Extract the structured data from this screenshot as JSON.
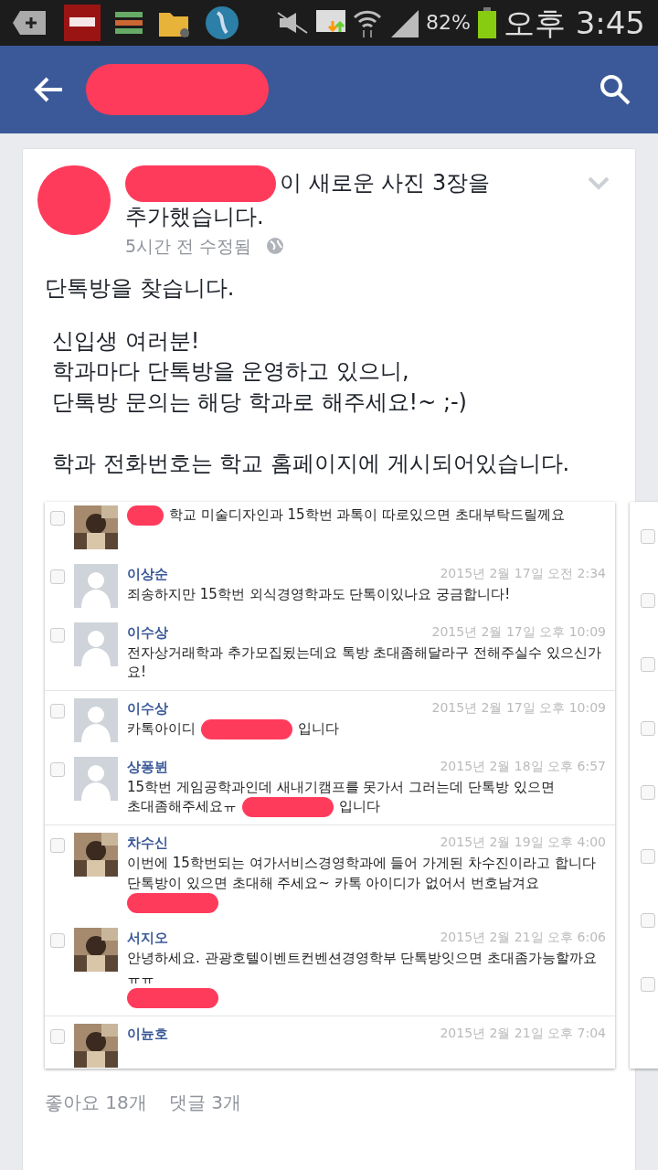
{
  "status_bar": {
    "battery": "82%",
    "time": "오후 3:45"
  },
  "post": {
    "action_lines": [
      "이 새로운 사진 3장을",
      "추가했습니다."
    ],
    "meta": "5시간 전 수정됨",
    "body": [
      [
        "단톡방을 찾습니다."
      ],
      [
        "신입생 여러분!",
        "학과마다 단톡방을 운영하고 있으니,",
        "단톡방 문의는 해당 학과로 해주세요!~ ;-)"
      ],
      [
        "학과 전화번호는 학교 홈페이지에 게시되어있습니다."
      ]
    ],
    "photo": {
      "comments": [
        {
          "checked": false,
          "divider": false,
          "parts": [
            {
              "kind": "redaction"
            },
            {
              "kind": "text",
              "text": "학교 미술디자인과 15학번 과톡이 따로있으면 초대부탁드릴께요"
            }
          ]
        },
        {
          "name": "이상순",
          "date": "2015년 2월 17일 오전 2:34",
          "kind": "default",
          "checked": false,
          "divider": false,
          "parts": [
            {
              "kind": "text",
              "text": "죄송하지만 15학번 외식경영학과도 단톡이있나요 궁금합니다!"
            }
          ]
        },
        {
          "name": "이수상",
          "date": "2015년 2월 17일 오후 10:09",
          "kind": "default",
          "checked": false,
          "divider": true,
          "parts": [
            {
              "kind": "text",
              "text": "전자상거래학과 추가모집됬는데요 톡방 초대좀해달라구 전해주실수 있으신가요!"
            }
          ]
        },
        {
          "name": "이수상",
          "date": "2015년 2월 17일 오후 10:09",
          "kind": "default",
          "checked": false,
          "divider": false,
          "parts": [
            {
              "kind": "text",
              "text": "카톡아이디"
            },
            {
              "kind": "redaction"
            },
            {
              "kind": "text",
              "text": "입니다"
            }
          ]
        },
        {
          "name": "상퐁뷘",
          "date": "2015년 2월 18일 오후 6:57",
          "kind": "default",
          "checked": false,
          "divider": true,
          "parts": [
            {
              "kind": "text",
              "text": "15학번 게임공학과인데 새내기캠프를 못가서 그러는데 단톡방 있으면"
            },
            {
              "kind": "text",
              "text": "초대좀해주세요ㅠ"
            },
            {
              "kind": "redaction"
            },
            {
              "kind": "text",
              "text": "입니다"
            }
          ]
        },
        {
          "name": "차수신",
          "date": "2015년 2월 19일 오후 4:00",
          "checked": false,
          "divider": false,
          "parts": [
            {
              "kind": "text",
              "text": "이번에 15학번되는 여가서비스경영학과에 들어 가게된 차수진이라고 합니다 단톡방이 있으면 초대해 주세요~ 카톡 아이디가 없어서 번호남겨요"
            },
            {
              "kind": "redaction"
            }
          ]
        },
        {
          "name": "서지오",
          "date": "2015년 2월 21일 오후 6:06",
          "checked": false,
          "divider": true,
          "parts": [
            {
              "kind": "text",
              "text": "안녕하세요. 관광호텔이벤트컨벤션경영학부 단톡방잇으면 초대좀가능할까요 ㅠㅠ"
            },
            {
              "kind": "redaction"
            }
          ]
        },
        {
          "name": "이뉸호",
          "date": "2015년 2월 21일 오후 7:04",
          "checked": false,
          "divider": false
        }
      ]
    },
    "side_checkboxes": [
      {
        "checked": false
      },
      {
        "checked": false
      },
      {
        "checked": false
      },
      {
        "checked": false
      },
      {
        "checked": false
      },
      {
        "checked": false
      },
      {
        "checked": false
      },
      {
        "checked": false
      }
    ],
    "likes": "좋아요 18개",
    "comments_count": "댓글 3개"
  }
}
